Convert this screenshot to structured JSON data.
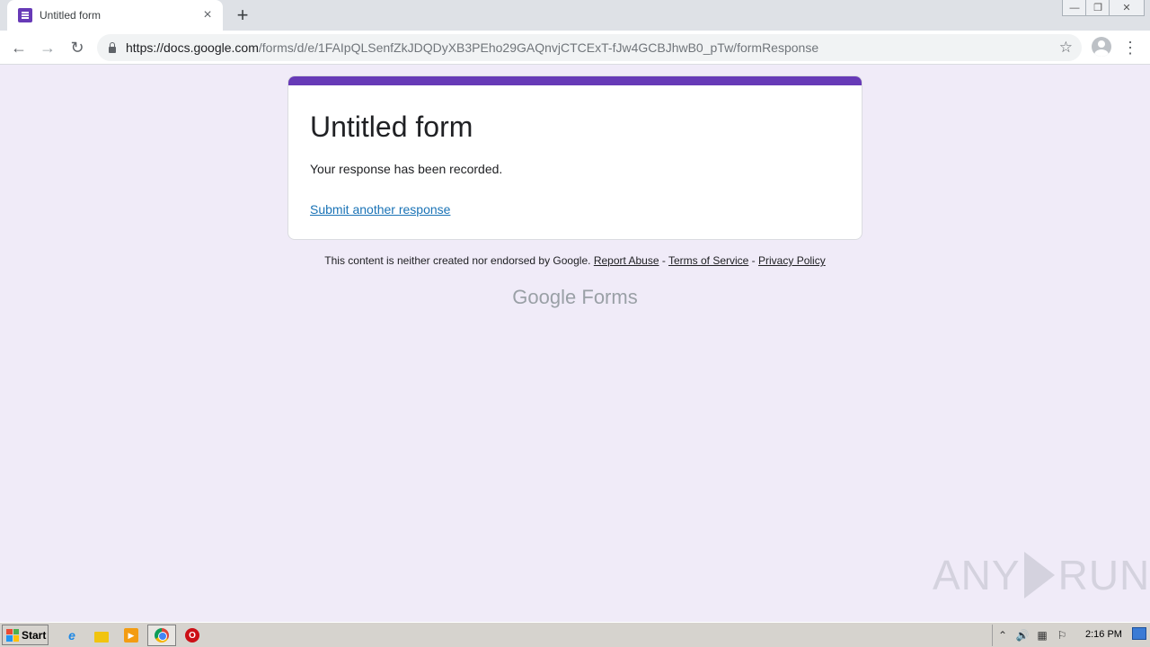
{
  "browser": {
    "tab_title": "Untitled form",
    "tab_close": "×",
    "new_tab": "+",
    "url_host": "https://docs.google.com",
    "url_path": "/forms/d/e/1FAIpQLSenfZkJDQDyXB3PEho29GAQnvjCTCExT-fJw4GCBJhwB0_pTw/formResponse",
    "back": "←",
    "forward": "→",
    "reload": "↻",
    "star": "☆",
    "menu": "⋮",
    "win_minimize": "—",
    "win_restore": "❐",
    "win_close": "✕"
  },
  "form": {
    "title": "Untitled form",
    "message": "Your response has been recorded.",
    "submit_another": "Submit another response"
  },
  "footer": {
    "disclaimer": "This content is neither created nor endorsed by Google.",
    "report_abuse": "Report Abuse",
    "sep1": " - ",
    "terms": "Terms of Service",
    "sep2": " - ",
    "privacy": "Privacy Policy",
    "brand_google": "Google",
    "brand_forms": "Forms"
  },
  "watermark": {
    "left": "ANY",
    "right": "RUN"
  },
  "taskbar": {
    "start": "Start",
    "ie": "e",
    "media": "▶",
    "opera": "O",
    "tray_up": "⌃",
    "tray_volume": "🔊",
    "tray_network": "▦",
    "tray_flag": "⚐",
    "clock": "2:16 PM"
  },
  "colors": {
    "accent": "#673ab7",
    "page_bg": "#f0ebf8",
    "link": "#1a73b6"
  }
}
